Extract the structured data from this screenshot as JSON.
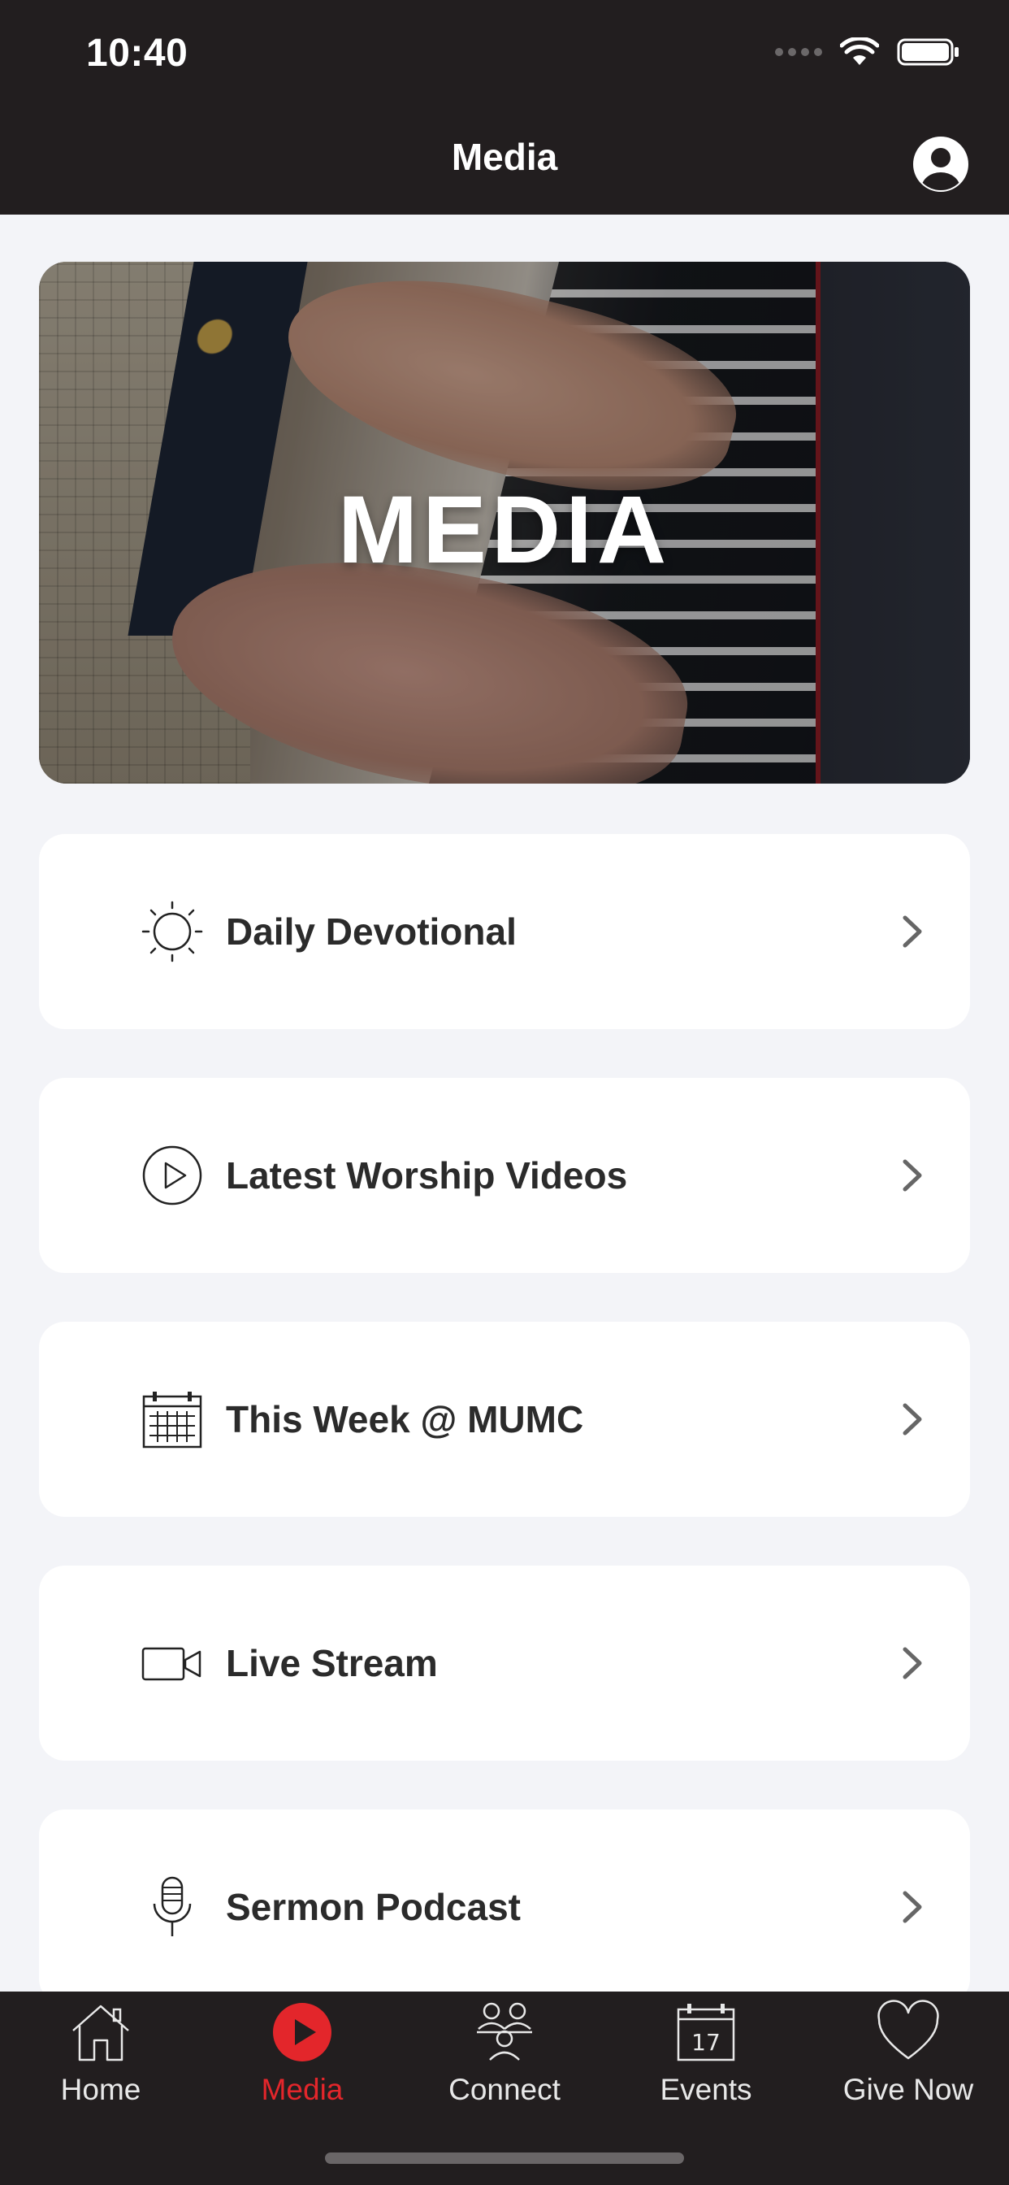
{
  "status_bar": {
    "time": "10:40"
  },
  "header": {
    "title": "Media",
    "profile_icon": "person-circle-icon"
  },
  "hero": {
    "title": "MEDIA"
  },
  "menu": [
    {
      "label": "Daily Devotional",
      "icon": "sun-icon"
    },
    {
      "label": "Latest Worship Videos",
      "icon": "play-circle-icon"
    },
    {
      "label": "This Week @ MUMC",
      "icon": "calendar-icon"
    },
    {
      "label": "Live Stream",
      "icon": "video-camera-icon"
    },
    {
      "label": "Sermon Podcast",
      "icon": "microphone-icon"
    }
  ],
  "tabs": [
    {
      "label": "Home",
      "icon": "house-icon",
      "active": false
    },
    {
      "label": "Media",
      "icon": "play-circle-icon",
      "active": true
    },
    {
      "label": "Connect",
      "icon": "group-icon",
      "active": false
    },
    {
      "label": "Events",
      "icon": "calendar-icon",
      "active": false,
      "date_text": "17"
    },
    {
      "label": "Give Now",
      "icon": "heart-icon",
      "active": false
    }
  ],
  "colors": {
    "bar_background": "#221e1f",
    "page_background": "#f3f4f8",
    "accent": "#e3262b",
    "card_text": "#2b2b2b"
  }
}
